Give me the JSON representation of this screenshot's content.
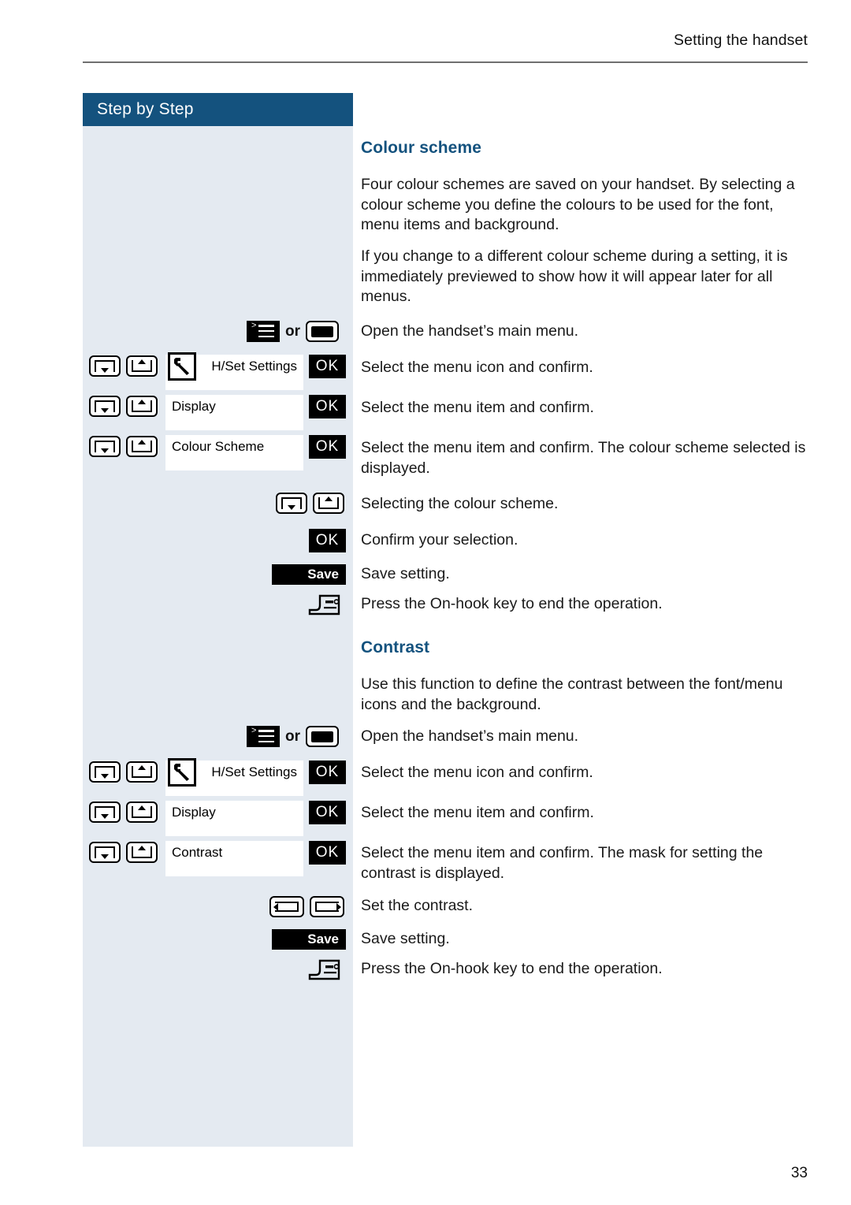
{
  "header": {
    "running_head": "Setting the handset"
  },
  "sidebar": {
    "banner_label": "Step by Step"
  },
  "page": {
    "number": "33"
  },
  "colors": {
    "brand_blue": "#14527e",
    "sidebar_bg": "#e4eaf1",
    "text": "#1a1a1a",
    "key_black": "#000000"
  },
  "sections": [
    {
      "id": "colour-scheme",
      "title": "Colour scheme",
      "paragraphs": [
        "Four colour schemes are saved on your handset. By selecting a colour scheme you define the colours to be used for the font, menu items and background.",
        "If you change to a different colour scheme during a setting, it is immediately previewed to show how it will appear later for all menus."
      ]
    },
    {
      "id": "contrast",
      "title": "Contrast",
      "paragraphs": [
        "Use this function to define the contrast between the font/menu icons and the background."
      ]
    }
  ],
  "steps": {
    "open_main_menu": "Open the handset’s main menu.",
    "select_menu_icon": "Select the menu icon and confirm.",
    "select_menu_item": "Select the menu item and confirm.",
    "select_item_colour_scheme": "Select the menu item and confirm. The colour scheme selected is displayed.",
    "selecting_colour_scheme": "Selecting the colour scheme.",
    "confirm_selection": "Confirm your selection.",
    "save_setting": "Save setting.",
    "on_hook_end": "Press the On-hook key to end the operation.",
    "select_item_contrast": "Select the menu item and confirm. The mask for setting the contrast is displayed.",
    "set_the_contrast": "Set the contrast."
  },
  "keys": {
    "or_label": "or",
    "ok_label": "OK",
    "save_label": "Save",
    "menu_key_icon": "menu-list-icon",
    "display_key_icon": "display-key-icon",
    "nav_down_icon": "navigation-key-down-icon",
    "nav_up_icon": "navigation-key-up-icon",
    "rocker_left_icon": "rocker-key-left-icon",
    "rocker_right_icon": "rocker-key-right-icon",
    "on_hook_icon": "on-hook-key-icon",
    "wrench_icon": "handset-settings-wrench-icon"
  },
  "menu_blocks": [
    {
      "id": "colour-scheme-menu",
      "rows": [
        {
          "label": "H/Set Settings",
          "align": "right",
          "has_wrench": true,
          "ok": "OK"
        },
        {
          "label": "Display",
          "align": "left",
          "has_wrench": false,
          "ok": "OK"
        },
        {
          "label": "Colour Scheme",
          "align": "left",
          "has_wrench": false,
          "ok": "OK"
        }
      ]
    },
    {
      "id": "contrast-menu",
      "rows": [
        {
          "label": "H/Set Settings",
          "align": "right",
          "has_wrench": true,
          "ok": "OK"
        },
        {
          "label": "Display",
          "align": "left",
          "has_wrench": false,
          "ok": "OK"
        },
        {
          "label": "Contrast",
          "align": "left",
          "has_wrench": false,
          "ok": "OK"
        }
      ]
    }
  ]
}
